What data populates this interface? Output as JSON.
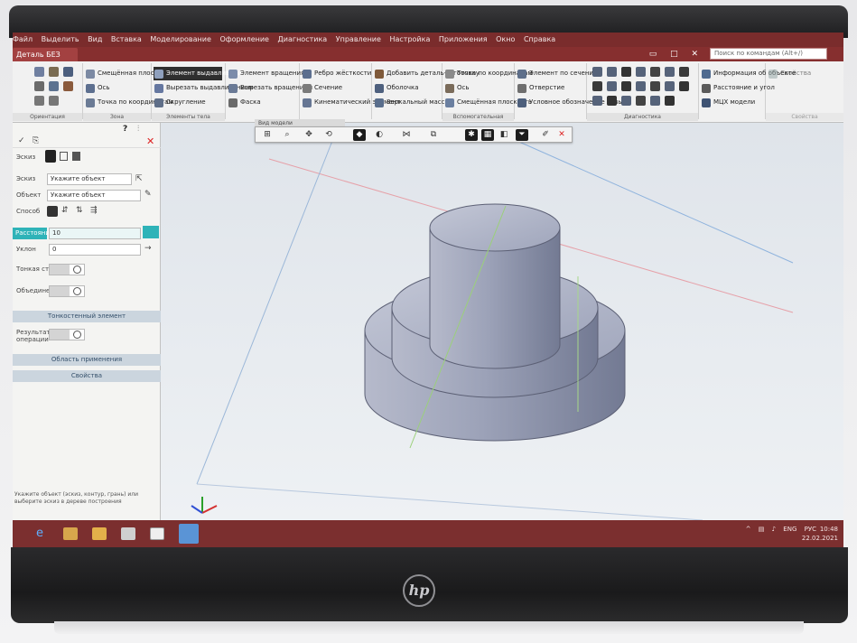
{
  "menubar": {
    "items": [
      "Файл",
      "Выделить",
      "Вид",
      "Вставка",
      "Моделирование",
      "Оформление",
      "Диагностика",
      "Управление",
      "Настройка",
      "Приложения",
      "Окно",
      "Справка"
    ]
  },
  "tabs": {
    "document": "Деталь БЕЗ ИМЕНИ",
    "search_placeholder": "Поиск по командам (Alt+/)"
  },
  "ribbon": {
    "groups": {
      "orientation": "Ориентация",
      "zones": "Зона",
      "elements": "Элементы тела",
      "auxiliary": "Вспомогательная геометрия",
      "diagnostics": "Диагностика",
      "properties": "Свойства"
    },
    "buttons": {
      "extrude": "Элемент выдавливания",
      "rotate": "Элемент вращения",
      "rounding": "Скругление",
      "cut_extrude": "Вырезать выдавливанием",
      "cut_rotate": "Вырезать вращением",
      "chamfer": "Фаска",
      "by_section": "Элемент по сечениям",
      "kinematic": "Кинематический элемент",
      "shell": "Оболочка",
      "rib": "Ребро жёсткости",
      "section": "Сечение",
      "thread": "Условное обозначение резьбы",
      "add_body": "Добавить деталь-заготовку",
      "holes": "Отверстие",
      "mirror": "Зеркальный массив",
      "point": "Точка по координатам",
      "axis": "Ось",
      "plane": "Смещённая плоскость",
      "mass": "МЦХ модели",
      "info": "Информация об объекте",
      "distance": "Расстояние и угол"
    }
  },
  "view_toolbar": {
    "label": "Вид модели"
  },
  "panel": {
    "tab_label": "Эскиз",
    "fields": {
      "sketch_label": "Эскиз",
      "sketch_value": "Укажите объект",
      "direction_label": "Объект",
      "direction_value": "Укажите объект",
      "method_label": "Способ",
      "distance_label": "Расстояние",
      "distance_value": "10",
      "angle_label": "Уклон",
      "angle_value": "0",
      "thin_wall_label": "Тонкая стенка",
      "merge_label": "Объединение",
      "result_label": "Результат операции"
    },
    "sections": {
      "thin": "Тонкостенный элемент",
      "scope": "Область применения",
      "props": "Свойства"
    },
    "hint": "Укажите объект (эскиз, контур, грань) или выберите эскиз в дереве построения"
  },
  "taskbar": {
    "tray": [
      "^",
      "ENG",
      "РУС"
    ],
    "time": "10:48",
    "date": "22.02.2021"
  },
  "colors": {
    "accent": "#7b2f2f",
    "panel_teal": "#2fb3b8",
    "model": "#8e95ad"
  }
}
